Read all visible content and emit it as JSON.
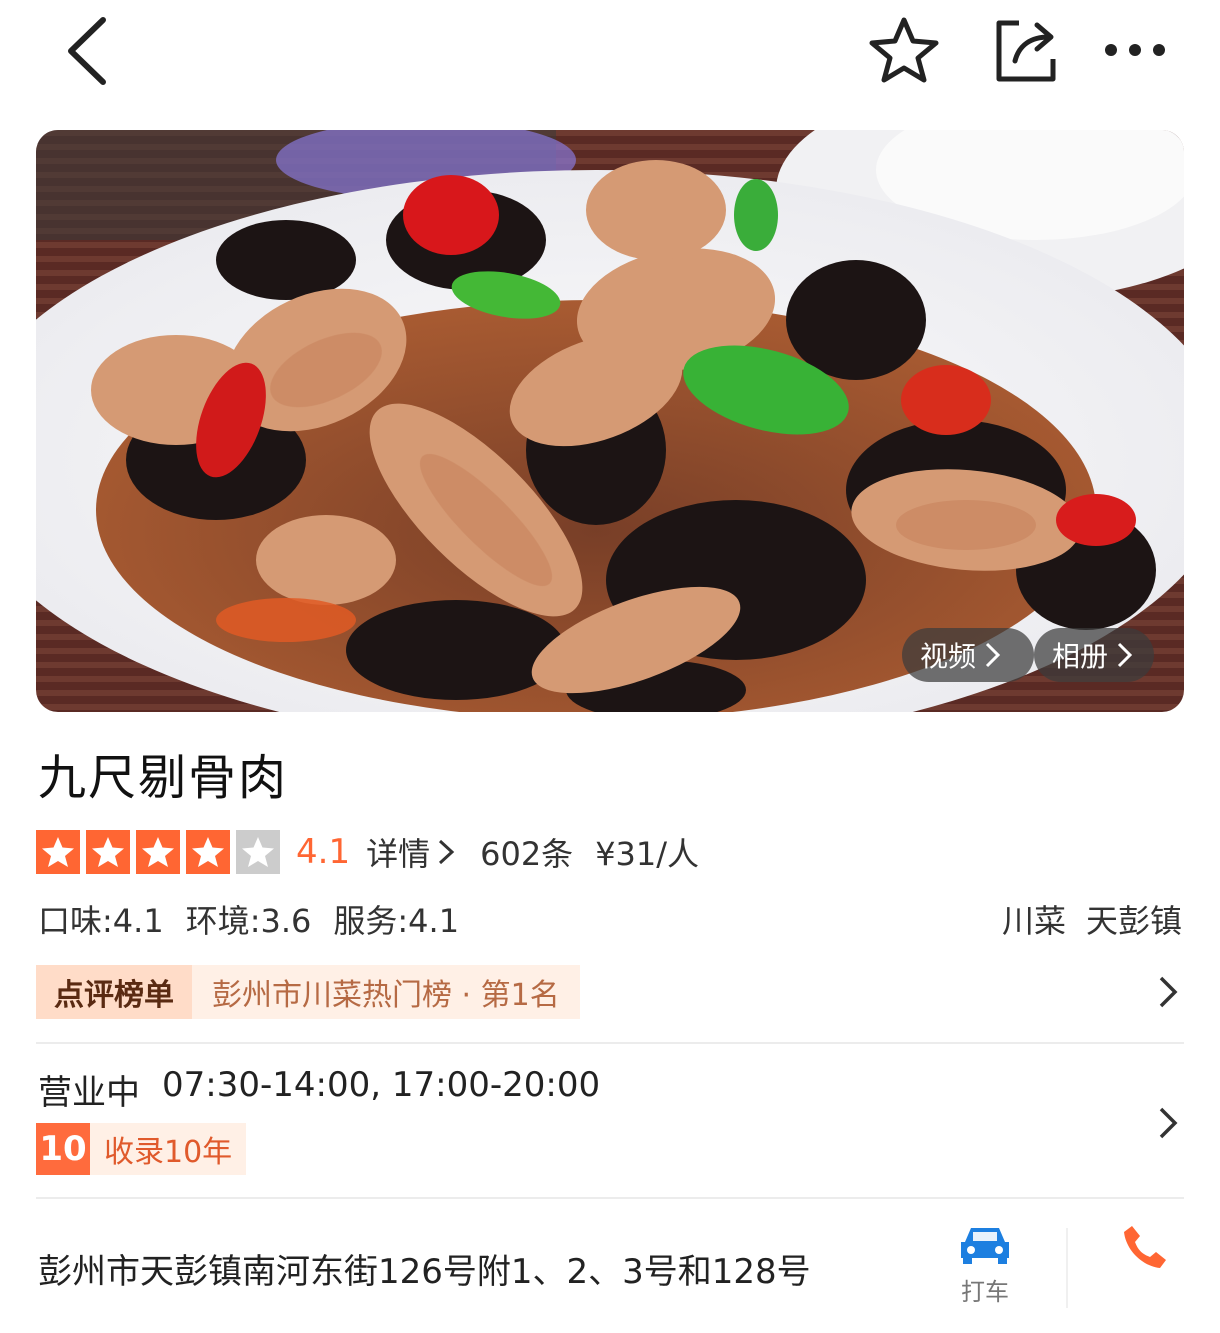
{
  "nav": {
    "back_icon": "chevron-left-icon",
    "favorite_icon": "star-outline-icon",
    "share_icon": "share-icon",
    "more_icon": "more-dots-icon"
  },
  "hero": {
    "video_label": "视频",
    "album_label": "相册"
  },
  "shop": {
    "name": "九尺剔骨肉",
    "stars": 4,
    "rating": "4.1",
    "details_label": "详情",
    "review_count": "602条",
    "price": "¥31/人",
    "scores": [
      "口味:4.1",
      "环境:3.6",
      "服务:4.1"
    ],
    "tags": [
      "川菜",
      "天彭镇"
    ]
  },
  "ranking": {
    "badge": "点评榜单",
    "text": "彭州市川菜热门榜 · 第1名"
  },
  "hours": {
    "status": "营业中",
    "time": "07:30-14:00, 17:00-20:00"
  },
  "listed": {
    "years": "10",
    "label": "收录10年"
  },
  "address": {
    "text": "彭州市天彭镇南河东街126号附1、2、3号和128号",
    "taxi_label": "打车",
    "taxi_icon": "car-icon",
    "phone_icon": "phone-icon"
  },
  "colors": {
    "accent": "#ff6633",
    "rank_bg": "#fff0e6",
    "years_badge": "#ff6b3d",
    "taxi_icon": "#1d7fe0",
    "phone_icon": "#ff6633"
  }
}
